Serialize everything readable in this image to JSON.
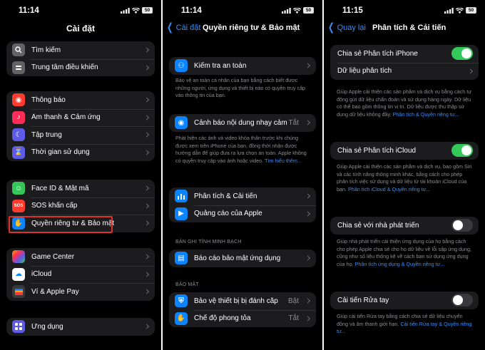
{
  "status": {
    "battery": "50"
  },
  "screen1": {
    "time": "11:14",
    "title": "Cài đặt",
    "group_a": [
      "Tìm kiếm",
      "Trung tâm điều khiển"
    ],
    "group_b": [
      "Thông báo",
      "Âm thanh & Cảm ứng",
      "Tập trung",
      "Thời gian sử dụng"
    ],
    "group_c": [
      "Face ID & Mật mã",
      "SOS khẩn cấp",
      "Quyền riêng tư & Bảo mật"
    ],
    "group_d": [
      "Game Center",
      "iCloud",
      "Ví & Apple Pay"
    ],
    "group_e": [
      "Ứng dụng"
    ],
    "sos_text": "SOS"
  },
  "screen2": {
    "time": "11:14",
    "back": "Cài đặt",
    "title": "Quyền riêng tư & Bảo mật",
    "safety_check": "Kiểm tra an toàn",
    "safety_desc": "Bảo vệ an toàn cá nhân của bạn bằng cách biết được những người, ứng dụng và thiết bị nào có quyền truy cập vào thông tin của bạn.",
    "sensitive": "Cảnh báo nội dung nhạy cảm",
    "sensitive_val": "Tắt",
    "sensitive_desc": "Phát hiện các ảnh và video khỏa thân trước khi chúng được xem trên iPhone của bạn, đồng thời nhận được hướng dẫn để giúp đưa ra lựa chọn an toàn. Apple không có quyền truy cập vào ảnh hoặc video.",
    "sensitive_link": "Tìm hiểu thêm...",
    "analytics": "Phân tích & Cải tiến",
    "ads": "Quảng cáo của Apple",
    "transparency_header": "BẢN GHI TÍNH MINH BẠCH",
    "app_privacy_report": "Báo cáo bảo mật ứng dụng",
    "security_header": "BẢO MẬT",
    "stolen_device": "Bảo vệ thiết bị bị đánh cắp",
    "stolen_val": "Bật",
    "lockdown": "Chế độ phong tỏa",
    "lockdown_val": "Tắt"
  },
  "screen3": {
    "time": "11:15",
    "back": "Quay lại",
    "title": "Phân tích & Cải tiến",
    "share_iphone": "Chia sẻ Phân tích iPhone",
    "analytics_data": "Dữ liệu phân tích",
    "iphone_desc": "Giúp Apple cải thiện các sản phẩm và dịch vụ bằng cách tự động gửi dữ liệu chẩn đoán và sử dụng hàng ngày. Dữ liệu có thể bao gồm thông tin vị trí. Dữ liệu được thu thập sử dụng dữ liệu không đầy.",
    "iphone_link": "Phân tích & Quyền riêng tư...",
    "share_icloud": "Chia sẻ Phân tích iCloud",
    "icloud_desc": "Giúp Apple cải thiện các sản phẩm và dịch vụ, bao gồm Siri và các tính năng thông minh khác, bằng cách cho phép phân tích việc sử dụng và dữ liệu từ tài khoản iCloud của bạn.",
    "icloud_link": "Phân tích iCloud & Quyền riêng tư...",
    "share_dev": "Chia sẻ với nhà phát triển",
    "dev_desc": "Giúp nhà phát triển cải thiện ứng dụng của họ bằng cách cho phép Apple chia sẻ cho họ dữ liệu về lỗi sập ứng dụng, cũng như số liệu thống kê về cách bạn sử dụng ứng dụng của họ.",
    "dev_link": "Phân tích ứng dụng & Quyền riêng tư...",
    "handwash": "Cải tiến Rửa tay",
    "handwash_desc": "Giúp cải tiến Rửa tay bằng cách chia sẻ dữ liệu chuyển động và âm thanh giới hạn.",
    "handwash_link": "Cải tiến Rửa tay & Quyền riêng tư...",
    "toggles": {
      "share_iphone": true,
      "share_icloud": true,
      "share_dev": false,
      "handwash": false
    }
  },
  "colors": {
    "accent": "#3a8df5",
    "highlight": "#e0302a",
    "toggle_on": "#34c759"
  }
}
